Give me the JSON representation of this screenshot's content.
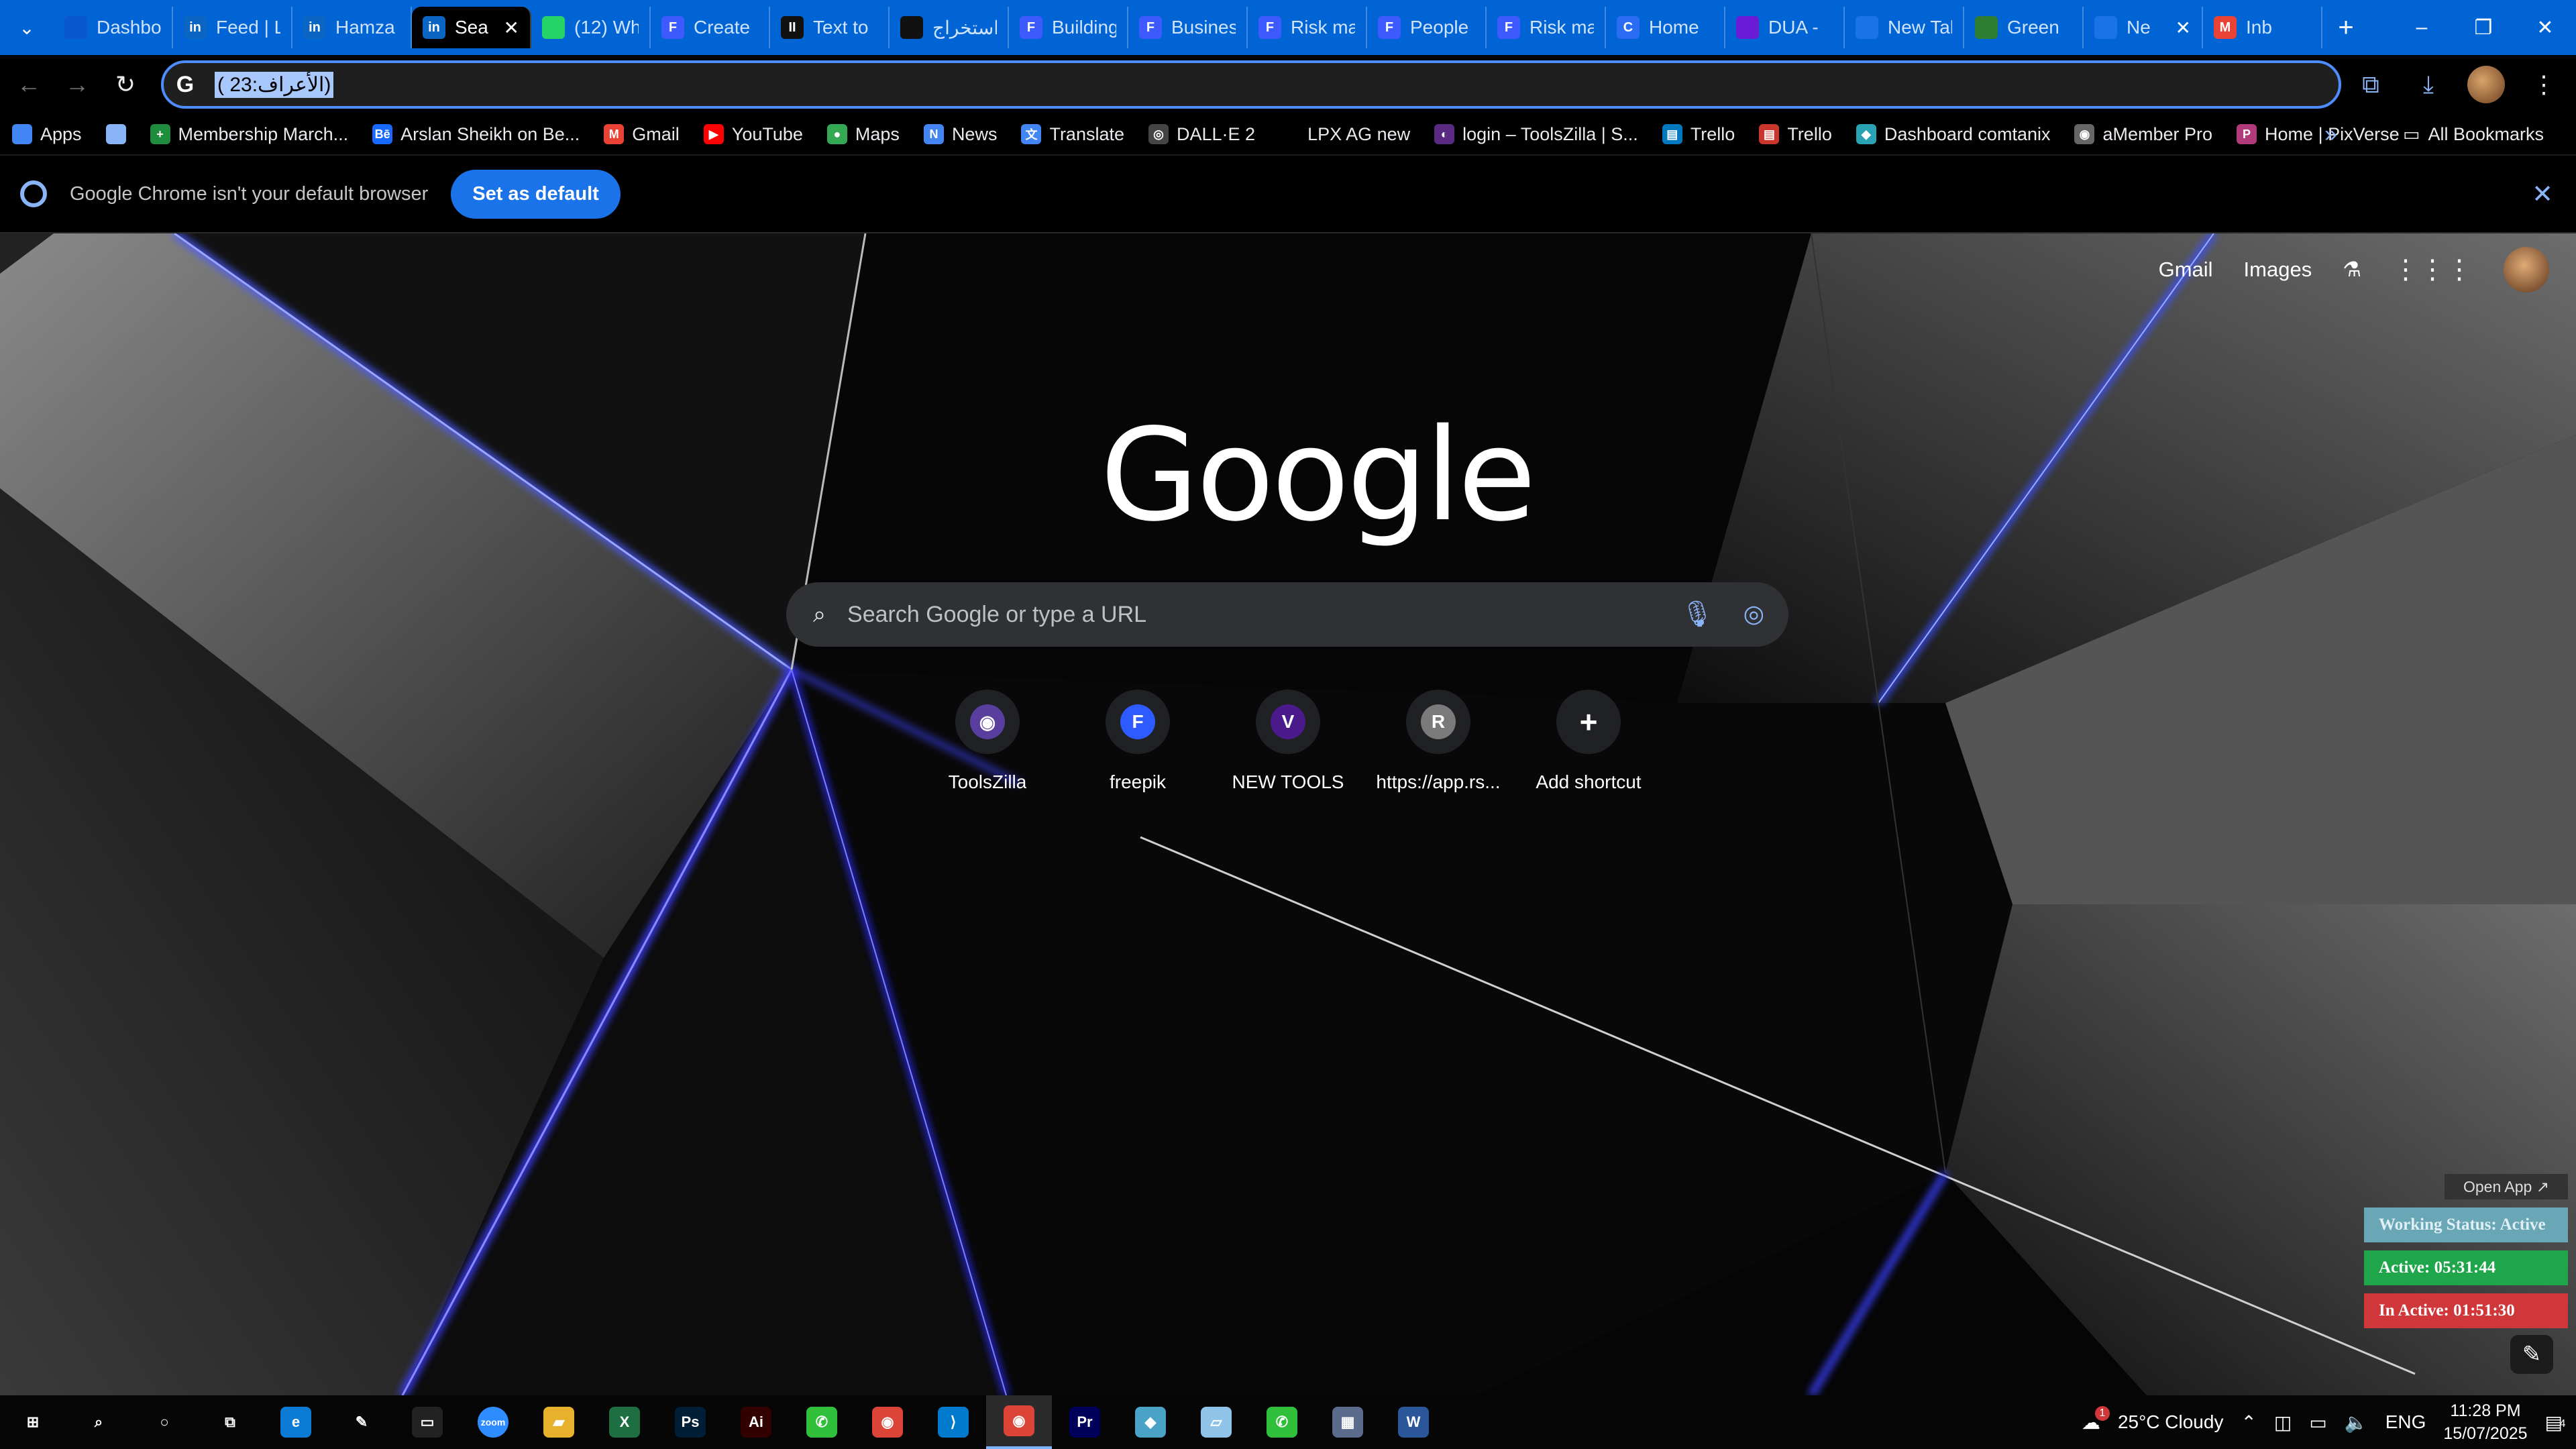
{
  "window": {
    "tabs": [
      {
        "title": "Dashbo",
        "favicon": "dashboard-icon",
        "color": "#0b57d0"
      },
      {
        "title": "Feed | L",
        "favicon": "in",
        "color": "#0a66c2"
      },
      {
        "title": "Hamza",
        "favicon": "in",
        "color": "#0a66c2"
      },
      {
        "title": "Sea",
        "favicon": "in",
        "color": "#0a66c2",
        "active": true
      },
      {
        "title": "(12) Wh",
        "favicon": "whatsapp-icon",
        "color": "#25d366"
      },
      {
        "title": "Create",
        "favicon": "F",
        "color": "#3d5afe"
      },
      {
        "title": "Text to",
        "favicon": "II",
        "color": "#111111"
      },
      {
        "title": "استخراج",
        "favicon": "openai-icon",
        "color": "#111111"
      },
      {
        "title": "Building",
        "favicon": "F",
        "color": "#3d5afe"
      },
      {
        "title": "Busines",
        "favicon": "F",
        "color": "#3d5afe"
      },
      {
        "title": "Risk ma",
        "favicon": "F",
        "color": "#3d5afe"
      },
      {
        "title": "People",
        "favicon": "F",
        "color": "#3d5afe"
      },
      {
        "title": "Risk ma",
        "favicon": "F",
        "color": "#3d5afe"
      },
      {
        "title": "Home",
        "favicon": "C",
        "color": "#2a6df4"
      },
      {
        "title": "DUA -",
        "favicon": "video-icon",
        "color": "#6a1bd6"
      },
      {
        "title": "New Tal",
        "favicon": "globe-icon",
        "color": "#1a73e8"
      },
      {
        "title": "Green",
        "favicon": "palm-icon",
        "color": "#2e7d32"
      },
      {
        "title": "Ne",
        "favicon": "globe-icon",
        "color": "#1a73e8",
        "close": true
      },
      {
        "title": "Inb",
        "favicon": "M",
        "color": "#ea4335"
      }
    ],
    "new_tab_label": "+",
    "controls": {
      "minimize": "–",
      "restore": "❐",
      "close": "✕"
    }
  },
  "toolbar": {
    "back": "←",
    "forward": "→",
    "reload": "↻",
    "address_value": "( الأعراف:23)",
    "address_icon": "G"
  },
  "bookmarks": {
    "items": [
      {
        "label": "Apps",
        "icon": "apps-grid-icon",
        "color": "#4285f4"
      },
      {
        "label": "",
        "icon": "tab-groups-icon",
        "color": "#8ab4f8"
      },
      {
        "label": "Membership March...",
        "icon": "+",
        "color": "#1e8e3e"
      },
      {
        "label": "Arslan Sheikh on Be...",
        "icon": "Bē",
        "color": "#1769ff"
      },
      {
        "label": "Gmail",
        "icon": "M",
        "color": "#ea4335"
      },
      {
        "label": "YouTube",
        "icon": "▶",
        "color": "#ff0000"
      },
      {
        "label": "Maps",
        "icon": "●",
        "color": "#34a853"
      },
      {
        "label": "News",
        "icon": "N",
        "color": "#4285f4"
      },
      {
        "label": "Translate",
        "icon": "文",
        "color": "#4285f4"
      },
      {
        "label": "DALL·E 2",
        "icon": "◎",
        "color": "#444444"
      },
      {
        "label": "LPX AG new",
        "icon": "",
        "color": "#000000"
      },
      {
        "label": "login – ToolsZilla | S...",
        "icon": "◐",
        "color": "#5a2a82"
      },
      {
        "label": "Trello",
        "icon": "▤",
        "color": "#0079bf"
      },
      {
        "label": "Trello",
        "icon": "▤",
        "color": "#c9372c"
      },
      {
        "label": "Dashboard comtanix",
        "icon": "◆",
        "color": "#29a3b3"
      },
      {
        "label": "aMember Pro",
        "icon": "◉",
        "color": "#666666"
      },
      {
        "label": "Home | PixVerse",
        "icon": "P",
        "color": "#b03a7a"
      }
    ],
    "more_label": "»",
    "all_bookmarks_label": "All Bookmarks"
  },
  "infobar": {
    "message": "Google Chrome isn't your default browser",
    "button": "Set as default",
    "close": "✕"
  },
  "ntp": {
    "top_links": {
      "gmail": "Gmail",
      "images": "Images"
    },
    "logo": "Google",
    "search_placeholder": "Search Google or type a URL",
    "shortcuts": [
      {
        "label": "ToolsZilla",
        "letter": "◉",
        "color": "#5a3e9e"
      },
      {
        "label": "freepik",
        "letter": "F",
        "color": "#2e5bff"
      },
      {
        "label": "NEW TOOLS",
        "letter": "V",
        "color": "#4a1a8a"
      },
      {
        "label": "https://app.rs...",
        "letter": "R",
        "color": "#7a7a7a"
      },
      {
        "label": "Add shortcut",
        "letter": "+",
        "color": "#202124"
      }
    ]
  },
  "tracker": {
    "open_app": "Open App ↗",
    "status": "Working Status: Active",
    "active": "Active: 05:31:44",
    "inactive": "In Active: 01:51:30"
  },
  "taskbar": {
    "apps": [
      {
        "name": "start-icon",
        "glyph": "⊞",
        "color": "#060606"
      },
      {
        "name": "search-icon",
        "glyph": "⌕",
        "color": "#060606"
      },
      {
        "name": "cortana-icon",
        "glyph": "○",
        "color": "#060606"
      },
      {
        "name": "task-view-icon",
        "glyph": "⧉",
        "color": "#060606"
      },
      {
        "name": "edge-icon",
        "glyph": "e",
        "color": "#0c7bd6"
      },
      {
        "name": "pen-icon",
        "glyph": "✎",
        "color": "#060606"
      },
      {
        "name": "terminal-icon",
        "glyph": "▭",
        "color": "#222222"
      },
      {
        "name": "zoom-icon",
        "glyph": "zoom",
        "color": "#2d8cff"
      },
      {
        "name": "file-explorer-icon",
        "glyph": "▰",
        "color": "#e8b12d"
      },
      {
        "name": "excel-icon",
        "glyph": "X",
        "color": "#1d6f42"
      },
      {
        "name": "photoshop-icon",
        "glyph": "Ps",
        "color": "#001e36"
      },
      {
        "name": "illustrator-icon",
        "glyph": "Ai",
        "color": "#330000"
      },
      {
        "name": "phone-app-icon",
        "glyph": "✆",
        "color": "#2fbf3a"
      },
      {
        "name": "chrome-icon",
        "glyph": "◉",
        "color": "#db4437"
      },
      {
        "name": "vscode-icon",
        "glyph": "⟩",
        "color": "#007acc"
      },
      {
        "name": "chrome-active-icon",
        "glyph": "◉",
        "color": "#db4437",
        "active": true
      },
      {
        "name": "premiere-icon",
        "glyph": "Pr",
        "color": "#00005b"
      },
      {
        "name": "app-diamond-icon",
        "glyph": "◆",
        "color": "#4aa3c7"
      },
      {
        "name": "notes-app-icon",
        "glyph": "▱",
        "color": "#8fc3e8"
      },
      {
        "name": "phone-app-2-icon",
        "glyph": "✆",
        "color": "#2fbf3a"
      },
      {
        "name": "calculator-icon",
        "glyph": "▦",
        "color": "#5b6b8c"
      },
      {
        "name": "word-icon",
        "glyph": "W",
        "color": "#2b579a"
      }
    ],
    "weather": "25°C  Cloudy",
    "weather_badge": "1",
    "language": "ENG",
    "time": "11:28 PM",
    "date": "15/07/2025",
    "notifications": "4"
  }
}
